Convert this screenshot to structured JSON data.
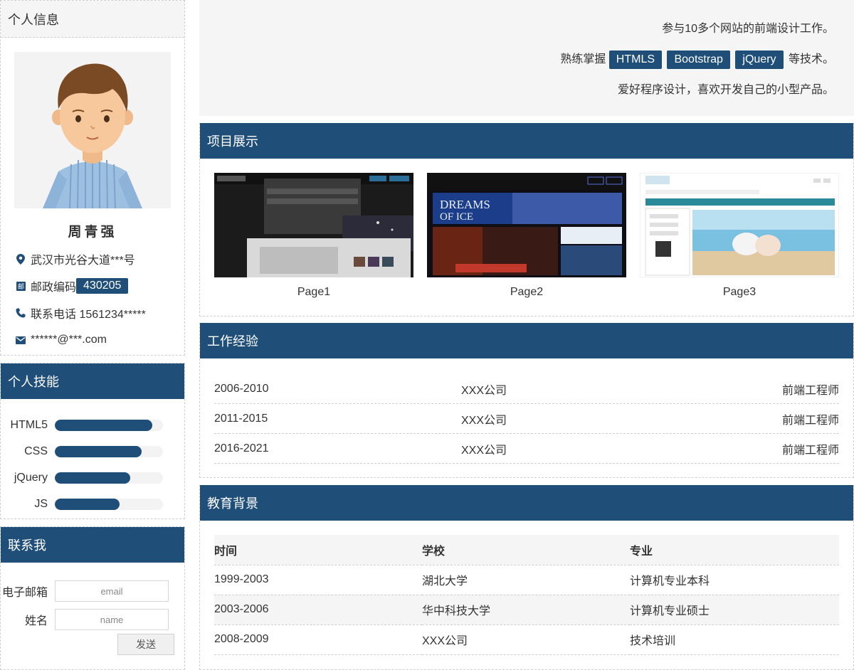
{
  "profile": {
    "title": "个人信息",
    "name": "周青强",
    "address": "武汉市光谷大道***号",
    "postal_label": "邮政编码",
    "postal_code": "430205",
    "phone": "联系电话 1561234*****",
    "email": "******@***.com"
  },
  "skills": {
    "title": "个人技能",
    "items": [
      {
        "name": "HTML5",
        "level": 0.9
      },
      {
        "name": "CSS",
        "level": 0.8
      },
      {
        "name": "jQuery",
        "level": 0.7
      },
      {
        "name": "JS",
        "level": 0.6
      }
    ]
  },
  "contact": {
    "title": "联系我",
    "email_label": "电子邮箱",
    "email_placeholder": "email",
    "name_label": "姓名",
    "name_placeholder": "name",
    "send_label": "发送"
  },
  "intro": {
    "line1": "参与10多个网站的前端设计工作。",
    "line2_prefix": "熟练掌握",
    "tags": [
      "HTMLS",
      "Bootstrap",
      "jQuery"
    ],
    "line2_suffix": "等技术。",
    "line3": "爱好程序设计，喜欢开发自己的小型产品。"
  },
  "projects": {
    "title": "项目展示",
    "items": [
      {
        "label": "Page1"
      },
      {
        "label": "Page2"
      },
      {
        "label": "Page3"
      }
    ]
  },
  "work": {
    "title": "工作经验",
    "rows": [
      {
        "period": "2006-2010",
        "company": "XXX公司",
        "role": "前端工程师"
      },
      {
        "period": "2011-2015",
        "company": "XXX公司",
        "role": "前端工程师"
      },
      {
        "period": "2016-2021",
        "company": "XXX公司",
        "role": "前端工程师"
      }
    ]
  },
  "education": {
    "title": "教育背景",
    "headers": [
      "时间",
      "学校",
      "专业"
    ],
    "rows": [
      {
        "period": "1999-2003",
        "school": "湖北大学",
        "major": "计算机专业本科"
      },
      {
        "period": "2003-2006",
        "school": "华中科技大学",
        "major": "计算机专业硕士"
      },
      {
        "period": "2008-2009",
        "school": "XXX公司",
        "major": "技术培训"
      }
    ]
  },
  "colors": {
    "accent": "#1f4e79",
    "panel_bg": "#f5f5f5"
  }
}
